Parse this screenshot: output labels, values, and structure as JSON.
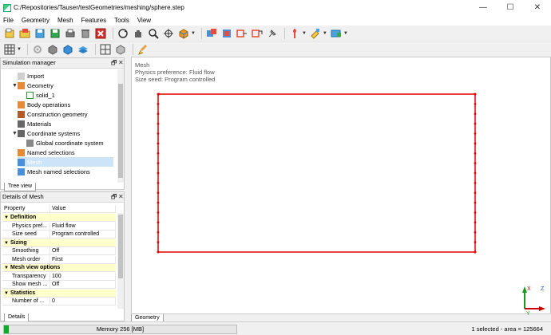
{
  "window": {
    "title": "C:/Repositories/Tauser/testGeometries/meshing/sphere.step",
    "minimize": "—",
    "maximize": "☐",
    "close": "✕"
  },
  "menu": [
    "File",
    "Geometry",
    "Mesh",
    "Features",
    "Tools",
    "View"
  ],
  "toolbar_row1_icons": [
    "new-file-icon",
    "open-file-icon",
    "import-icon",
    "save-icon",
    "print-icon",
    "delete-icon",
    "close-red-icon",
    "rotate-icon",
    "pan-hand-icon",
    "zoom-icon",
    "fit-view-icon",
    "view-cube-icon",
    "select-box-icon",
    "select-face-icon",
    "select-edge-icon",
    "select-arrow-icon",
    "pin-icon",
    "probe-icon",
    "highlight-icon",
    "screenshot-icon"
  ],
  "toolbar_row2_icons": [
    "grid-icon",
    "settings-icon",
    "solid-gray-icon",
    "solid-blue-icon",
    "layers-icon",
    "wireframe-icon",
    "shaded-icon",
    "brush-icon"
  ],
  "simulation_manager": {
    "title": "Simulation manager",
    "float": "🗗",
    "close": "✕",
    "items": [
      {
        "label": "Import",
        "icon": "import-icon",
        "indent": 1,
        "expand": ""
      },
      {
        "label": "Geometry",
        "icon": "geometry-icon",
        "indent": 0,
        "expand": "▼"
      },
      {
        "label": "solid_1",
        "icon": "solid-icon",
        "indent": 2,
        "expand": ""
      },
      {
        "label": "Body operations",
        "icon": "body-operations-icon",
        "indent": 1,
        "expand": ""
      },
      {
        "label": "Construction geometry",
        "icon": "construction-geometry-icon",
        "indent": 1,
        "expand": ""
      },
      {
        "label": "Materials",
        "icon": "materials-icon",
        "indent": 1,
        "expand": ""
      },
      {
        "label": "Coordinate systems",
        "icon": "coordinate-systems-icon",
        "indent": 0,
        "expand": "▼"
      },
      {
        "label": "Global coordinate system",
        "icon": "axis-icon",
        "indent": 2,
        "expand": ""
      },
      {
        "label": "Named selections",
        "icon": "named-selections-icon",
        "indent": 1,
        "expand": ""
      },
      {
        "label": "Mesh",
        "icon": "mesh-icon",
        "indent": 1,
        "expand": "",
        "selected": true
      },
      {
        "label": "Mesh named selections",
        "icon": "mesh-named-selections-icon",
        "indent": 1,
        "expand": ""
      }
    ],
    "tab": "Tree view"
  },
  "details": {
    "title": "Details of Mesh",
    "float": "🗗",
    "close": "✕",
    "columns": [
      "Property",
      "Value"
    ],
    "rows": [
      {
        "type": "cat",
        "toggle": "▼",
        "label": "Definition"
      },
      {
        "type": "prop",
        "name": "Physics pref...",
        "value": "Fluid flow"
      },
      {
        "type": "prop",
        "name": "Size seed",
        "value": "Program controlled"
      },
      {
        "type": "cat",
        "toggle": "▼",
        "label": "Sizing"
      },
      {
        "type": "prop",
        "name": "Smoothing",
        "value": "Off"
      },
      {
        "type": "prop",
        "name": "Mesh order",
        "value": "First"
      },
      {
        "type": "cat",
        "toggle": "▼",
        "label": "Mesh view options"
      },
      {
        "type": "prop",
        "name": "Transparency",
        "value": "100"
      },
      {
        "type": "prop",
        "name": "Show mesh ...",
        "value": "Off"
      },
      {
        "type": "cat",
        "toggle": "▼",
        "label": "Statistics"
      },
      {
        "type": "prop",
        "name": "Number of ...",
        "value": "0"
      }
    ],
    "tab": "Details"
  },
  "viewport": {
    "info": [
      "Mesh",
      "Physics preference: Fluid flow",
      "Size seed: Program controlled"
    ],
    "tab": "Geometry",
    "axis_x": "X",
    "axis_y": "Y",
    "axis_z": "Z",
    "rect_color": "#e00000",
    "edge_points_per_side": 16
  },
  "status": {
    "memory": "Memory 256 [MB]",
    "memory_fill_fraction": 0.02,
    "right": "1 selected - area = 125664"
  },
  "colors": {
    "selection_bg": "#cce4f7",
    "mesh_red": "#e00000",
    "memory_green": "#06b025",
    "category_bg": "#ffffcc"
  }
}
